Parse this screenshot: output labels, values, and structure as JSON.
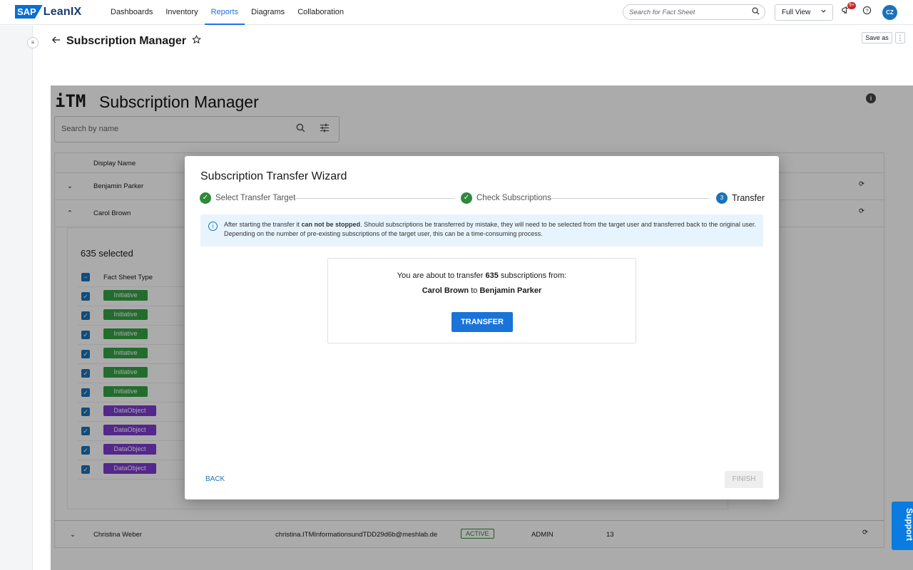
{
  "brand": {
    "sap": "SAP",
    "product": "LeanIX"
  },
  "nav": [
    "Dashboards",
    "Inventory",
    "Reports",
    "Diagrams",
    "Collaboration"
  ],
  "topbar": {
    "search_placeholder": "Search for Fact Sheet",
    "view": "Full View",
    "notif_badge": "9+",
    "avatar": "CZ"
  },
  "page": {
    "title": "Subscription Manager",
    "save_as": "Save as",
    "more": "⋮"
  },
  "report": {
    "logo": "iTM",
    "title": "Subscription Manager",
    "search_placeholder": "Search by name",
    "col_display_name": "Display Name",
    "rows": [
      {
        "name": "Benjamin Parker"
      },
      {
        "name": "Carol Brown"
      },
      {
        "name": "Christina Weber",
        "email": "christina.ITMInformationsundTDD29d6b@meshlab.de",
        "status": "ACTIVE",
        "role": "ADMIN",
        "count": "13"
      }
    ],
    "selected": "635 selected",
    "col_fact_sheet_type": "Fact Sheet Type",
    "fact_sheets": [
      "Initiative",
      "Initiative",
      "Initiative",
      "Initiative",
      "Initiative",
      "Initiative",
      "DataObject",
      "DataObject",
      "DataObject",
      "DataObject"
    ]
  },
  "wizard": {
    "title": "Subscription Transfer Wizard",
    "steps": [
      "Select Transfer Target",
      "Check Subscriptions",
      "Transfer"
    ],
    "step3_num": "3",
    "info_pre": "After starting the transfer it ",
    "info_bold": "can not be stopped",
    "info_post": ". Should subscriptions be transferred by mistake, they will need to be selected from the target user and transferred back to the original user. Depending on the number of pre-existing subscriptions of the target user, this can be a time-consuming process.",
    "confirm_pre": "You are about to transfer ",
    "confirm_count": "635",
    "confirm_post": " subscriptions from:",
    "from_user": "Carol Brown",
    "to_word": " to ",
    "to_user": "Benjamin Parker",
    "transfer_button": "TRANSFER",
    "back_button": "BACK",
    "finish_button": "FINISH"
  },
  "support": "Support"
}
